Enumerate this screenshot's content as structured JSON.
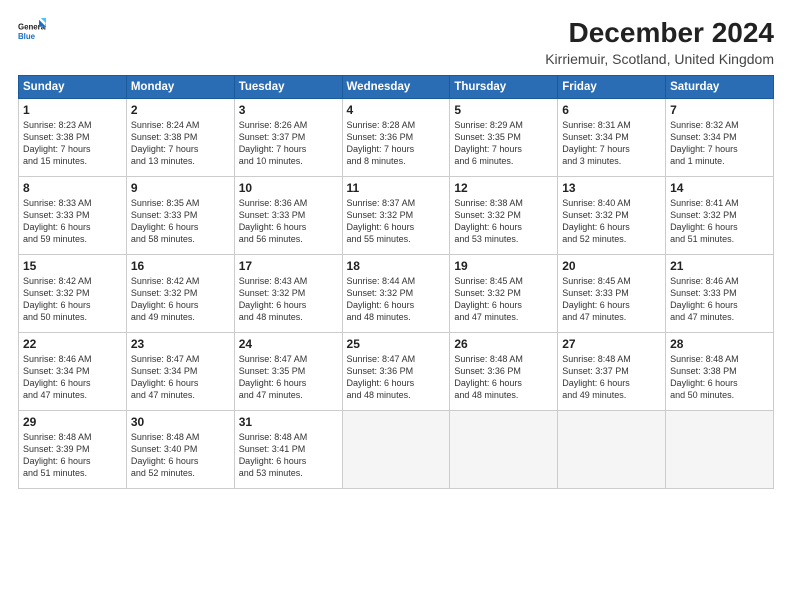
{
  "logo": {
    "line1": "General",
    "line2": "Blue"
  },
  "title": "December 2024",
  "subtitle": "Kirriemuir, Scotland, United Kingdom",
  "days_header": [
    "Sunday",
    "Monday",
    "Tuesday",
    "Wednesday",
    "Thursday",
    "Friday",
    "Saturday"
  ],
  "weeks": [
    [
      {
        "day": "1",
        "lines": [
          "Sunrise: 8:23 AM",
          "Sunset: 3:38 PM",
          "Daylight: 7 hours",
          "and 15 minutes."
        ]
      },
      {
        "day": "2",
        "lines": [
          "Sunrise: 8:24 AM",
          "Sunset: 3:38 PM",
          "Daylight: 7 hours",
          "and 13 minutes."
        ]
      },
      {
        "day": "3",
        "lines": [
          "Sunrise: 8:26 AM",
          "Sunset: 3:37 PM",
          "Daylight: 7 hours",
          "and 10 minutes."
        ]
      },
      {
        "day": "4",
        "lines": [
          "Sunrise: 8:28 AM",
          "Sunset: 3:36 PM",
          "Daylight: 7 hours",
          "and 8 minutes."
        ]
      },
      {
        "day": "5",
        "lines": [
          "Sunrise: 8:29 AM",
          "Sunset: 3:35 PM",
          "Daylight: 7 hours",
          "and 6 minutes."
        ]
      },
      {
        "day": "6",
        "lines": [
          "Sunrise: 8:31 AM",
          "Sunset: 3:34 PM",
          "Daylight: 7 hours",
          "and 3 minutes."
        ]
      },
      {
        "day": "7",
        "lines": [
          "Sunrise: 8:32 AM",
          "Sunset: 3:34 PM",
          "Daylight: 7 hours",
          "and 1 minute."
        ]
      }
    ],
    [
      {
        "day": "8",
        "lines": [
          "Sunrise: 8:33 AM",
          "Sunset: 3:33 PM",
          "Daylight: 6 hours",
          "and 59 minutes."
        ]
      },
      {
        "day": "9",
        "lines": [
          "Sunrise: 8:35 AM",
          "Sunset: 3:33 PM",
          "Daylight: 6 hours",
          "and 58 minutes."
        ]
      },
      {
        "day": "10",
        "lines": [
          "Sunrise: 8:36 AM",
          "Sunset: 3:33 PM",
          "Daylight: 6 hours",
          "and 56 minutes."
        ]
      },
      {
        "day": "11",
        "lines": [
          "Sunrise: 8:37 AM",
          "Sunset: 3:32 PM",
          "Daylight: 6 hours",
          "and 55 minutes."
        ]
      },
      {
        "day": "12",
        "lines": [
          "Sunrise: 8:38 AM",
          "Sunset: 3:32 PM",
          "Daylight: 6 hours",
          "and 53 minutes."
        ]
      },
      {
        "day": "13",
        "lines": [
          "Sunrise: 8:40 AM",
          "Sunset: 3:32 PM",
          "Daylight: 6 hours",
          "and 52 minutes."
        ]
      },
      {
        "day": "14",
        "lines": [
          "Sunrise: 8:41 AM",
          "Sunset: 3:32 PM",
          "Daylight: 6 hours",
          "and 51 minutes."
        ]
      }
    ],
    [
      {
        "day": "15",
        "lines": [
          "Sunrise: 8:42 AM",
          "Sunset: 3:32 PM",
          "Daylight: 6 hours",
          "and 50 minutes."
        ]
      },
      {
        "day": "16",
        "lines": [
          "Sunrise: 8:42 AM",
          "Sunset: 3:32 PM",
          "Daylight: 6 hours",
          "and 49 minutes."
        ]
      },
      {
        "day": "17",
        "lines": [
          "Sunrise: 8:43 AM",
          "Sunset: 3:32 PM",
          "Daylight: 6 hours",
          "and 48 minutes."
        ]
      },
      {
        "day": "18",
        "lines": [
          "Sunrise: 8:44 AM",
          "Sunset: 3:32 PM",
          "Daylight: 6 hours",
          "and 48 minutes."
        ]
      },
      {
        "day": "19",
        "lines": [
          "Sunrise: 8:45 AM",
          "Sunset: 3:32 PM",
          "Daylight: 6 hours",
          "and 47 minutes."
        ]
      },
      {
        "day": "20",
        "lines": [
          "Sunrise: 8:45 AM",
          "Sunset: 3:33 PM",
          "Daylight: 6 hours",
          "and 47 minutes."
        ]
      },
      {
        "day": "21",
        "lines": [
          "Sunrise: 8:46 AM",
          "Sunset: 3:33 PM",
          "Daylight: 6 hours",
          "and 47 minutes."
        ]
      }
    ],
    [
      {
        "day": "22",
        "lines": [
          "Sunrise: 8:46 AM",
          "Sunset: 3:34 PM",
          "Daylight: 6 hours",
          "and 47 minutes."
        ]
      },
      {
        "day": "23",
        "lines": [
          "Sunrise: 8:47 AM",
          "Sunset: 3:34 PM",
          "Daylight: 6 hours",
          "and 47 minutes."
        ]
      },
      {
        "day": "24",
        "lines": [
          "Sunrise: 8:47 AM",
          "Sunset: 3:35 PM",
          "Daylight: 6 hours",
          "and 47 minutes."
        ]
      },
      {
        "day": "25",
        "lines": [
          "Sunrise: 8:47 AM",
          "Sunset: 3:36 PM",
          "Daylight: 6 hours",
          "and 48 minutes."
        ]
      },
      {
        "day": "26",
        "lines": [
          "Sunrise: 8:48 AM",
          "Sunset: 3:36 PM",
          "Daylight: 6 hours",
          "and 48 minutes."
        ]
      },
      {
        "day": "27",
        "lines": [
          "Sunrise: 8:48 AM",
          "Sunset: 3:37 PM",
          "Daylight: 6 hours",
          "and 49 minutes."
        ]
      },
      {
        "day": "28",
        "lines": [
          "Sunrise: 8:48 AM",
          "Sunset: 3:38 PM",
          "Daylight: 6 hours",
          "and 50 minutes."
        ]
      }
    ],
    [
      {
        "day": "29",
        "lines": [
          "Sunrise: 8:48 AM",
          "Sunset: 3:39 PM",
          "Daylight: 6 hours",
          "and 51 minutes."
        ]
      },
      {
        "day": "30",
        "lines": [
          "Sunrise: 8:48 AM",
          "Sunset: 3:40 PM",
          "Daylight: 6 hours",
          "and 52 minutes."
        ]
      },
      {
        "day": "31",
        "lines": [
          "Sunrise: 8:48 AM",
          "Sunset: 3:41 PM",
          "Daylight: 6 hours",
          "and 53 minutes."
        ]
      },
      null,
      null,
      null,
      null
    ]
  ]
}
